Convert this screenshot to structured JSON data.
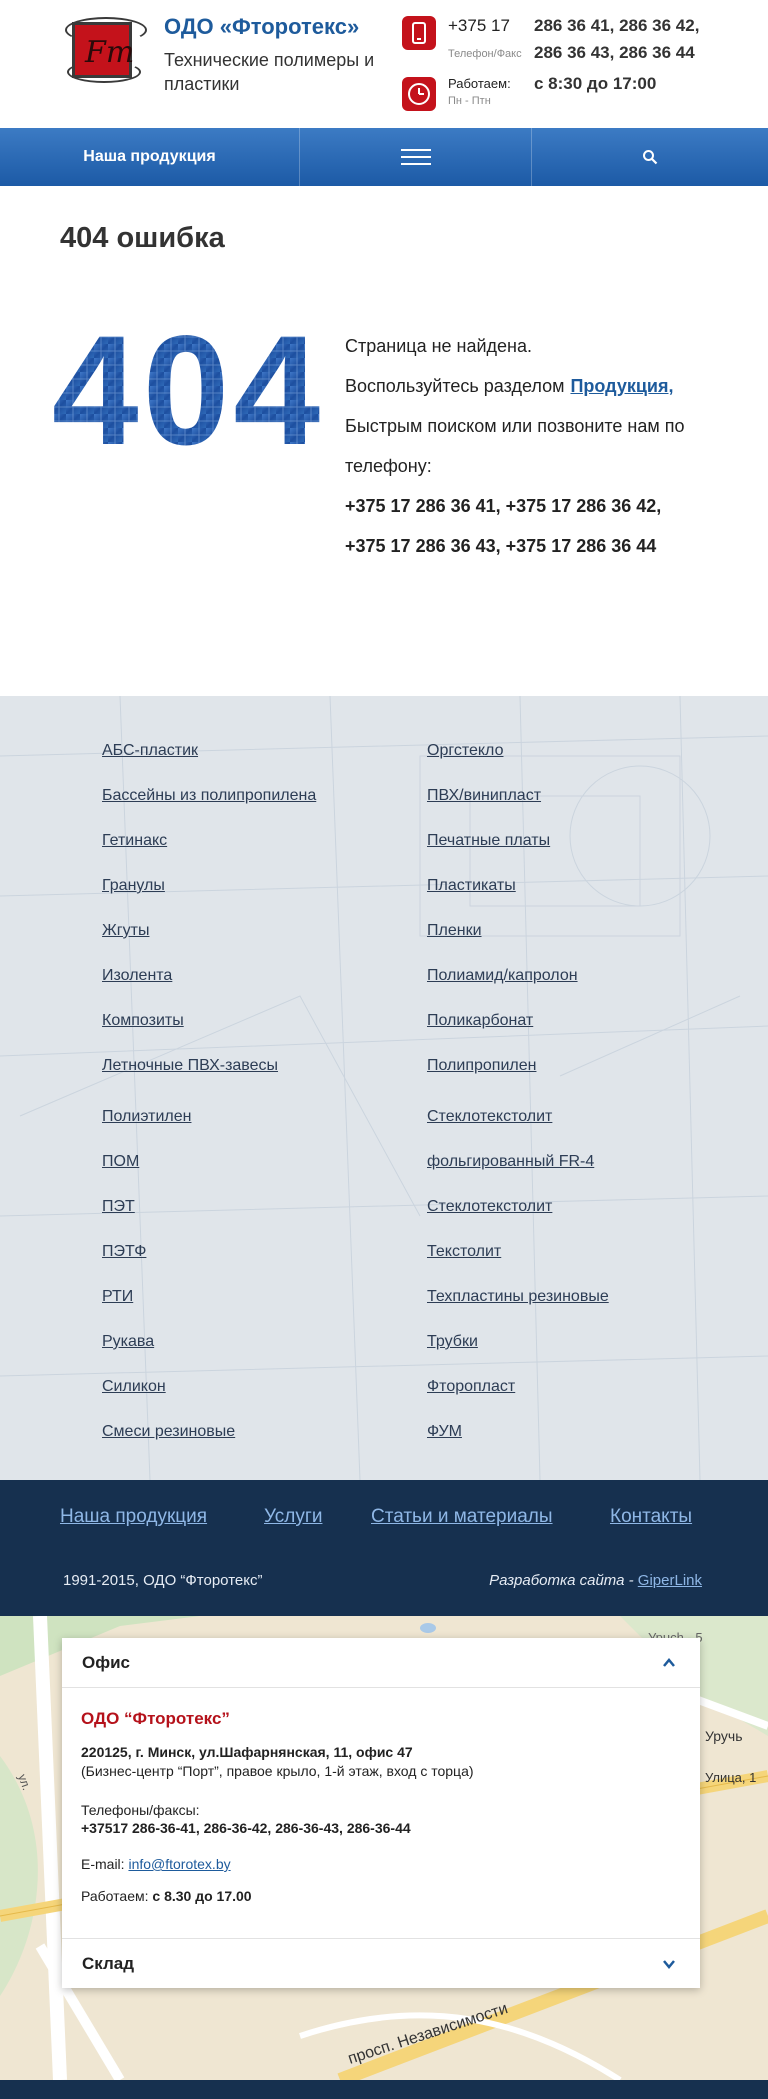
{
  "header": {
    "logo_letters": "Fт",
    "brand_title": "ОДО «Фторотекс»",
    "brand_sub": "Технические полимеры и пластики",
    "phone": {
      "prefix": "+375 17",
      "label": "Телефон/Факс",
      "numbers_line1": "286 36 41, 286 36 42,",
      "numbers_line2": "286 36 43, 286 36 44"
    },
    "work": {
      "label": "Работаем:",
      "days": "Пн - Птн",
      "hours": "с 8:30 до 17:00"
    },
    "icons": {
      "phone": "phone-icon",
      "clock": "clock-icon"
    },
    "accent": "#c4121b"
  },
  "nav": {
    "products": "Наша продукция",
    "menu_icon": "hamburger-menu-icon",
    "search_icon": "search-icon",
    "color": "#1c5aa6"
  },
  "main": {
    "title": "404 ошибка",
    "big_code": "404",
    "line1": "Страница не найдена.",
    "line2_prefix": "Воспользуйтесь разделом",
    "line2_link": "Продукция,",
    "line3": "Быстрым поиском или позвоните нам по телефону:",
    "phones_line1": "+375 17 286 36 41, +375 17 286 36 42,",
    "phones_line2": "+375 17 286 36 43, +375 17 286 36 44"
  },
  "catalog": {
    "left": [
      "АБС-пластик",
      "Бассейны из полипропилена",
      "Гетинакс",
      "Гранулы",
      "Жгуты",
      "Изолента",
      "Композиты",
      "Летночные ПВХ-завесы",
      "Полиэтилен",
      "ПОМ",
      "ПЭТ",
      "ПЭТФ",
      "РТИ",
      "Рукава",
      "Силикон",
      "Смеси резиновые"
    ],
    "right": [
      "Оргстекло",
      "ПВХ/винипласт",
      "Печатные платы",
      "Пластикаты",
      "Пленки",
      "Полиамид/капролон",
      "Поликарбонат",
      "Полипропилен",
      "Стеклотекстолит",
      "фольгированный FR-4",
      "Стеклотекстолит",
      "Текстолит",
      "Техпластины резиновые",
      "Трубки",
      "Фторопласт",
      "ФУМ"
    ]
  },
  "footer": {
    "links": [
      "Наша продукция",
      "Услуги",
      "Статьи и материалы",
      "Контакты"
    ],
    "copyright": "1991-2015, ОДО “Фторотекс”",
    "dev_prefix": "Разработка сайта - ",
    "dev_link": "GiperLink",
    "bg": "#16304f"
  },
  "map": {
    "labels": {
      "street1": "просп. Независимости",
      "street2": "ул.",
      "place1": "Уручь",
      "place2": "Улица, 1",
      "place3": "Урuch - 5"
    },
    "office": {
      "title": "Офис",
      "company": "ОДО “Фторотекс”",
      "address": "220125, г. Минск, ул.Шафарнянская, 11, офис 47",
      "address_note": "(Бизнес-центр “Порт”, правое крыло, 1-й этаж, вход с торца)",
      "phones_label": "Телефоны/факсы:",
      "phones": "+37517 286-36-41, 286-36-42, 286-36-43, 286-36-44",
      "email_label": "E-mail:",
      "email": "info@ftorotex.by",
      "work_label": "Работаем:",
      "work_hours": "с 8.30 до 17.00",
      "expand_icon": "chevron-up-icon"
    },
    "warehouse": {
      "title": "Склад",
      "expand_icon": "chevron-down-icon"
    }
  }
}
